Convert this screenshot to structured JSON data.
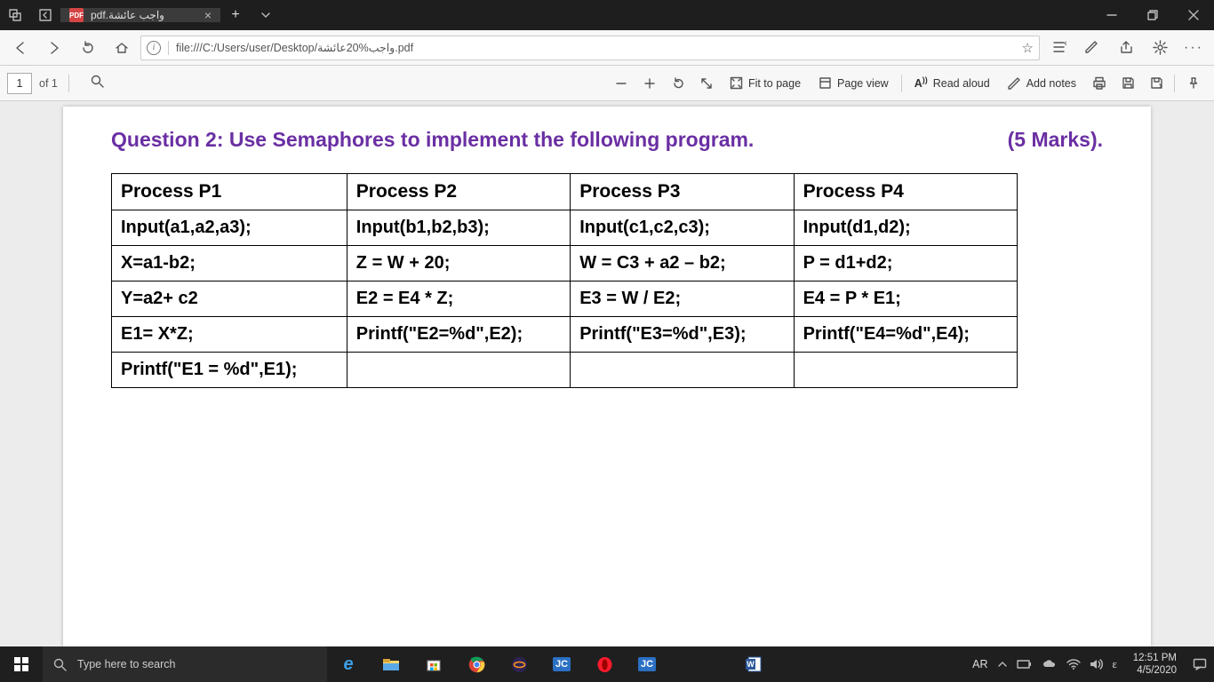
{
  "titlebar": {
    "tab_title": "pdf.واجب عائشة",
    "tab_icon_label": "PDF"
  },
  "addressbar": {
    "url": "file:///C:/Users/user/Desktop/واجب%20عائشة.pdf"
  },
  "pdfbar": {
    "page_current": "1",
    "page_of": "of 1",
    "fit_to_page": "Fit to page",
    "page_view": "Page view",
    "read_aloud": "Read aloud",
    "add_notes": "Add notes"
  },
  "document": {
    "question": "Question 2: Use Semaphores to implement the following program.",
    "marks": "(5 Marks).",
    "headers": [
      "Process P1",
      "Process P2",
      "Process P3",
      "Process P4"
    ],
    "rows": [
      [
        "Input(a1,a2,a3);",
        "Input(b1,b2,b3);",
        "Input(c1,c2,c3);",
        "Input(d1,d2);"
      ],
      [
        "X=a1-b2;",
        "Z = W + 20;",
        "W = C3 + a2 – b2;",
        "P = d1+d2;"
      ],
      [
        "Y=a2+ c2",
        "E2 = E4 * Z;",
        "E3 = W / E2;",
        "E4 = P * E1;"
      ],
      [
        "E1= X*Z;",
        "Printf(\"E2=%d\",E2);",
        "Printf(\"E3=%d\",E3);",
        "Printf(\"E4=%d\",E4);"
      ],
      [
        "Printf(\"E1 = %d\",E1);",
        "",
        "",
        ""
      ]
    ]
  },
  "taskbar": {
    "search_placeholder": "Type here to search",
    "lang": "AR",
    "ime": "ε",
    "time": "12:51 PM",
    "date": "4/5/2020"
  }
}
